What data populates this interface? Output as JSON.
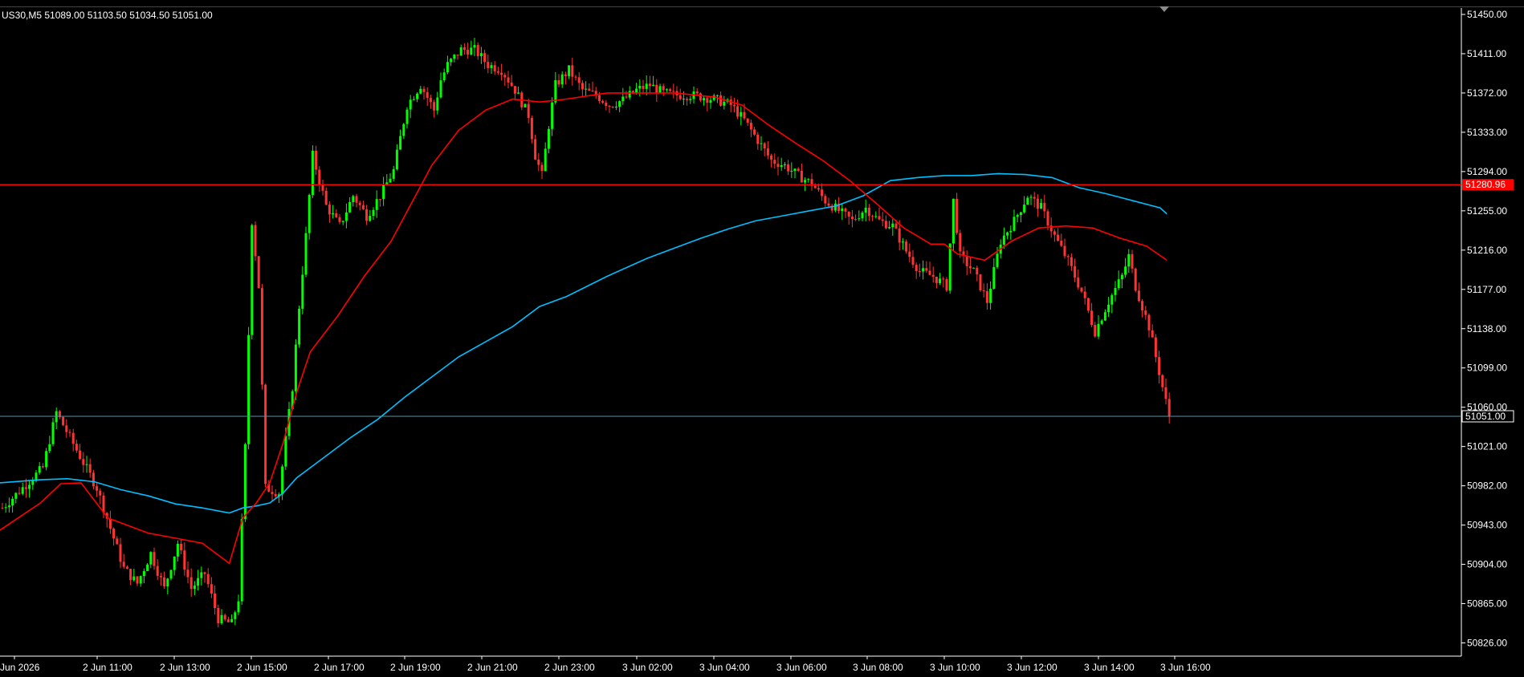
{
  "header": {
    "symbol_info": "US30,M5  51089.00 51103.50 51034.50 51051.00"
  },
  "colors": {
    "background": "#000000",
    "bull": "#00ff00",
    "bear": "#ff3333",
    "ma_fast": "#ff0000",
    "ma_slow": "#00bfff",
    "hline": "#ff0000",
    "bidline": "#5f8fa8",
    "axis": "#ffffff"
  },
  "chart_data": {
    "type": "candlestick",
    "symbol": "US30",
    "timeframe": "M5",
    "ohlc_last": {
      "open": 51089.0,
      "high": 51103.5,
      "low": 51034.5,
      "close": 51051.0
    },
    "ylim": [
      50826.0,
      51450.0
    ],
    "y_ticks": [
      "51450.00",
      "51411.00",
      "51372.00",
      "51333.00",
      "51294.00",
      "51255.00",
      "51216.00",
      "51177.00",
      "51138.00",
      "51099.00",
      "51060.00",
      "51021.00",
      "50982.00",
      "50943.00",
      "50904.00",
      "50865.00",
      "50826.00"
    ],
    "x_ticks": [
      "Jun 2026",
      "2 Jun 11:00",
      "2 Jun 13:00",
      "2 Jun 15:00",
      "2 Jun 17:00",
      "2 Jun 19:00",
      "2 Jun 21:00",
      "2 Jun 23:00",
      "3 Jun 02:00",
      "3 Jun 04:00",
      "3 Jun 06:00",
      "3 Jun 08:00",
      "3 Jun 10:00",
      "3 Jun 12:00",
      "3 Jun 14:00",
      "3 Jun 16:00"
    ],
    "horizontal_line": {
      "value": 51280.96,
      "label": "51280.96"
    },
    "bid_line": {
      "value": 51051.0,
      "label": "51051.00"
    },
    "price_path": [
      [
        0,
        50960
      ],
      [
        6,
        51000
      ],
      [
        8,
        51055
      ],
      [
        10,
        51030
      ],
      [
        14,
        50980
      ],
      [
        18,
        50900
      ],
      [
        20,
        50885
      ],
      [
        22,
        50915
      ],
      [
        24,
        50880
      ],
      [
        26,
        50925
      ],
      [
        28,
        50880
      ],
      [
        30,
        50895
      ],
      [
        32,
        50850
      ],
      [
        34,
        50845
      ],
      [
        35,
        50870
      ],
      [
        36,
        51020
      ],
      [
        37,
        51245
      ],
      [
        38,
        51180
      ],
      [
        39,
        50980
      ],
      [
        41,
        50975
      ],
      [
        43,
        51080
      ],
      [
        44,
        51160
      ],
      [
        45,
        51230
      ],
      [
        46,
        51310
      ],
      [
        48,
        51260
      ],
      [
        50,
        51240
      ],
      [
        52,
        51270
      ],
      [
        54,
        51250
      ],
      [
        56,
        51270
      ],
      [
        58,
        51295
      ],
      [
        60,
        51360
      ],
      [
        62,
        51380
      ],
      [
        64,
        51355
      ],
      [
        65,
        51385
      ],
      [
        66,
        51400
      ],
      [
        68,
        51415
      ],
      [
        70,
        51415
      ],
      [
        72,
        51400
      ],
      [
        74,
        51395
      ],
      [
        76,
        51375
      ],
      [
        78,
        51350
      ],
      [
        79,
        51310
      ],
      [
        80,
        51290
      ],
      [
        81,
        51340
      ],
      [
        82,
        51380
      ],
      [
        84,
        51395
      ],
      [
        86,
        51375
      ],
      [
        88,
        51370
      ],
      [
        90,
        51360
      ],
      [
        92,
        51365
      ],
      [
        94,
        51375
      ],
      [
        96,
        51380
      ],
      [
        98,
        51372
      ],
      [
        100,
        51370
      ],
      [
        102,
        51370
      ],
      [
        104,
        51368
      ],
      [
        106,
        51365
      ],
      [
        108,
        51360
      ],
      [
        110,
        51345
      ],
      [
        112,
        51325
      ],
      [
        114,
        51305
      ],
      [
        116,
        51300
      ],
      [
        118,
        51290
      ],
      [
        120,
        51282
      ],
      [
        122,
        51265
      ],
      [
        124,
        51255
      ],
      [
        126,
        51245
      ],
      [
        128,
        51258
      ],
      [
        130,
        51245
      ],
      [
        132,
        51240
      ],
      [
        134,
        51215
      ],
      [
        136,
        51195
      ],
      [
        138,
        51190
      ],
      [
        140,
        51180
      ],
      [
        141,
        51265
      ],
      [
        142,
        51210
      ],
      [
        144,
        51195
      ],
      [
        146,
        51165
      ],
      [
        148,
        51225
      ],
      [
        150,
        51245
      ],
      [
        152,
        51270
      ],
      [
        154,
        51258
      ],
      [
        156,
        51230
      ],
      [
        158,
        51205
      ],
      [
        160,
        51175
      ],
      [
        162,
        51135
      ],
      [
        164,
        51165
      ],
      [
        166,
        51190
      ],
      [
        167,
        51210
      ],
      [
        168,
        51180
      ],
      [
        170,
        51140
      ],
      [
        172,
        51080
      ],
      [
        173,
        51051
      ]
    ],
    "ma_fast_path": [
      [
        0,
        50938
      ],
      [
        6,
        50965
      ],
      [
        9,
        50984
      ],
      [
        12,
        50985
      ],
      [
        16,
        50950
      ],
      [
        22,
        50935
      ],
      [
        26,
        50930
      ],
      [
        30,
        50925
      ],
      [
        34,
        50905
      ],
      [
        36,
        50950
      ],
      [
        38,
        50965
      ],
      [
        40,
        50985
      ],
      [
        42,
        51025
      ],
      [
        44,
        51075
      ],
      [
        46,
        51115
      ],
      [
        50,
        51150
      ],
      [
        54,
        51190
      ],
      [
        58,
        51225
      ],
      [
        60,
        51250
      ],
      [
        62,
        51275
      ],
      [
        64,
        51300
      ],
      [
        68,
        51335
      ],
      [
        72,
        51355
      ],
      [
        76,
        51366
      ],
      [
        80,
        51363
      ],
      [
        84,
        51366
      ],
      [
        90,
        51372
      ],
      [
        96,
        51372
      ],
      [
        100,
        51372
      ],
      [
        106,
        51368
      ],
      [
        110,
        51360
      ],
      [
        114,
        51340
      ],
      [
        118,
        51322
      ],
      [
        122,
        51305
      ],
      [
        126,
        51285
      ],
      [
        130,
        51262
      ],
      [
        134,
        51238
      ],
      [
        138,
        51222
      ],
      [
        140,
        51222
      ],
      [
        142,
        51212
      ],
      [
        146,
        51206
      ],
      [
        150,
        51225
      ],
      [
        154,
        51238
      ],
      [
        158,
        51240
      ],
      [
        162,
        51238
      ],
      [
        166,
        51228
      ],
      [
        170,
        51220
      ],
      [
        173,
        51206
      ]
    ],
    "ma_slow_path": [
      [
        0,
        50985
      ],
      [
        6,
        50988
      ],
      [
        10,
        50989
      ],
      [
        14,
        50986
      ],
      [
        18,
        50978
      ],
      [
        22,
        50972
      ],
      [
        26,
        50964
      ],
      [
        30,
        50960
      ],
      [
        34,
        50955
      ],
      [
        36,
        50960
      ],
      [
        38,
        50962
      ],
      [
        40,
        50965
      ],
      [
        42,
        50975
      ],
      [
        44,
        50990
      ],
      [
        48,
        51010
      ],
      [
        52,
        51030
      ],
      [
        56,
        51048
      ],
      [
        60,
        51070
      ],
      [
        64,
        51090
      ],
      [
        68,
        51110
      ],
      [
        72,
        51125
      ],
      [
        76,
        51140
      ],
      [
        80,
        51160
      ],
      [
        84,
        51170
      ],
      [
        90,
        51190
      ],
      [
        96,
        51208
      ],
      [
        100,
        51218
      ],
      [
        104,
        51228
      ],
      [
        108,
        51237
      ],
      [
        112,
        51245
      ],
      [
        116,
        51250
      ],
      [
        120,
        51255
      ],
      [
        124,
        51260
      ],
      [
        128,
        51270
      ],
      [
        132,
        51285
      ],
      [
        136,
        51288
      ],
      [
        140,
        51290
      ],
      [
        144,
        51290
      ],
      [
        148,
        51292
      ],
      [
        152,
        51291
      ],
      [
        156,
        51288
      ],
      [
        160,
        51278
      ],
      [
        164,
        51272
      ],
      [
        168,
        51265
      ],
      [
        172,
        51258
      ],
      [
        173,
        51252
      ]
    ]
  }
}
